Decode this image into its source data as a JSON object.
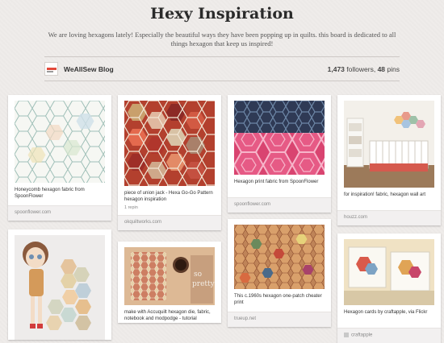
{
  "board": {
    "title": "Hexy Inspiration",
    "description": "We are loving hexagons lately! Especially the beautiful ways they have been popping up in quilts. this board is dedicated to all things hexagon that keep us inspired!"
  },
  "owner": {
    "name": "WeAllSew Blog",
    "followers": "1,473",
    "followers_label": "followers,",
    "pins": "48",
    "pins_label": "pins"
  },
  "pins": [
    {
      "image": "white-hexagon-fabric-swatch",
      "description": "Honeycomb hexagon fabric from SpoonFlower",
      "source": "spoonflower.com"
    },
    {
      "image": "red-hexagon-patchwork-quilt",
      "description": "piece of union jack - Hexa Go-Go Pattern hexagon inspiration",
      "repins": "1 repin",
      "source": "okquiltworks.com"
    },
    {
      "image": "pink-navy-hexagon-print",
      "description": "Hexagon print fabric from SpoonFlower",
      "source": "spoonflower.com"
    },
    {
      "image": "nursery-room-hexagon-wall-art",
      "description": "for inspiration! fabric, hexagon wall art",
      "source": "houzz.com"
    },
    {
      "image": "doll-with-hexagon-patches",
      "description": "",
      "source": ""
    },
    {
      "image": "hexagon-notebook-and-coffee",
      "description": "make with Accuquilt hexagon die, fabric, notebook and modpodge - tutorial",
      "source": ""
    },
    {
      "image": "hexagon-one-patch-cheater-print",
      "description": "This c.1960s hexagon one-patch cheater print",
      "source": "trueup.net"
    },
    {
      "image": "hexagon-greeting-cards",
      "description": "Hexagon cards by craftapple, via Flickr",
      "source": "craftapple"
    }
  ]
}
